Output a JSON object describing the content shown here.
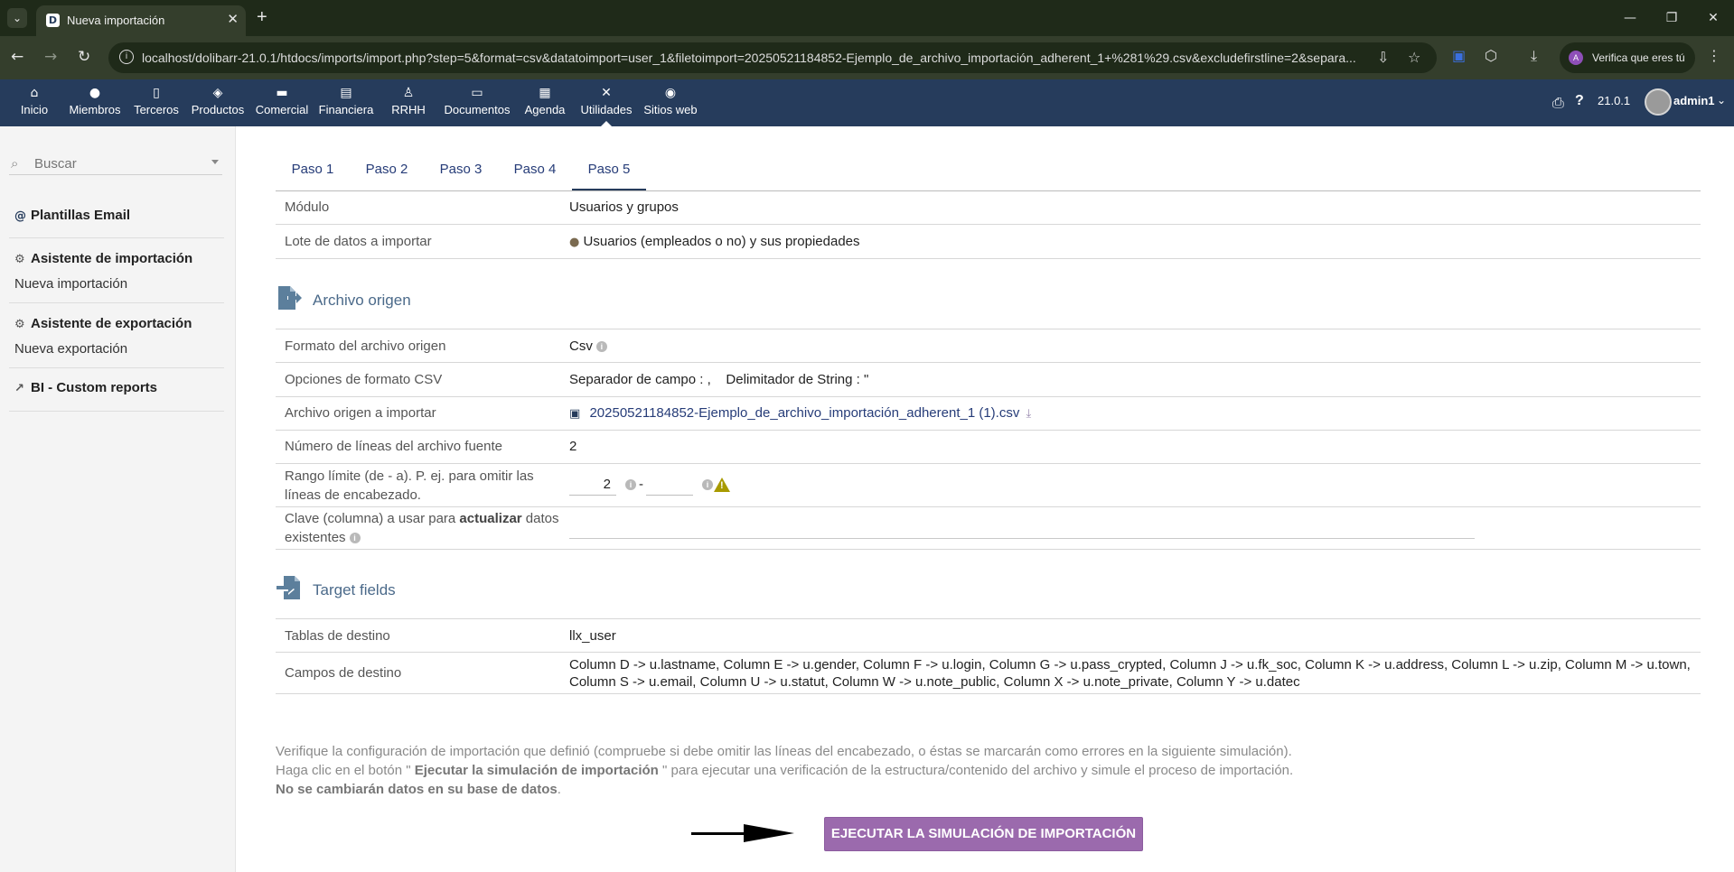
{
  "browser": {
    "tab_title": "Nueva importación",
    "favicon_letter": "D",
    "url": "localhost/dolibarr-21.0.1/htdocs/imports/import.php?step=5&format=csv&datatoimport=user_1&filetoimport=20250521184852-Ejemplo_de_archivo_importación_adherent_1+%281%29.csv&excludefirstline=2&separa...",
    "profile_chip": "Verifica que eres tú",
    "profile_initial": "A"
  },
  "topmenu": {
    "items": [
      {
        "label": "Inicio",
        "icon": "home-icon"
      },
      {
        "label": "Miembros",
        "icon": "user-icon"
      },
      {
        "label": "Terceros",
        "icon": "building-icon"
      },
      {
        "label": "Productos",
        "icon": "cube-icon"
      },
      {
        "label": "Comercial",
        "icon": "briefcase-icon"
      },
      {
        "label": "Financiera",
        "icon": "invoice-icon"
      },
      {
        "label": "RRHH",
        "icon": "person-tie-icon"
      },
      {
        "label": "Documentos",
        "icon": "folder-icon"
      },
      {
        "label": "Agenda",
        "icon": "calendar-icon"
      },
      {
        "label": "Utilidades",
        "icon": "tools-icon"
      },
      {
        "label": "Sitios web",
        "icon": "globe-icon"
      }
    ],
    "active": "Utilidades",
    "version": "21.0.1",
    "username": "admin1"
  },
  "sidebar": {
    "search_placeholder": "Buscar",
    "email_templates": "Plantillas Email",
    "import_wizard": "Asistente de importación",
    "new_import": "Nueva importación",
    "export_wizard": "Asistente de exportación",
    "new_export": "Nueva exportación",
    "bi_reports": "BI - Custom reports"
  },
  "steps": [
    "Paso 1",
    "Paso 2",
    "Paso 3",
    "Paso 4",
    "Paso 5"
  ],
  "active_step": "Paso 5",
  "general": {
    "module_label": "Módulo",
    "module_value": "Usuarios y grupos",
    "dataset_label": "Lote de datos a importar",
    "dataset_value": "Usuarios (empleados o no) y sus propiedades"
  },
  "source_section": {
    "title": "Archivo origen",
    "format_label": "Formato del archivo origen",
    "format_value": "Csv",
    "csv_options_label": "Opciones de formato CSV",
    "csv_options_value": "Separador de campo : ,    Delimitador de String : \"",
    "file_label": "Archivo origen a importar",
    "file_value": "20250521184852-Ejemplo_de_archivo_importación_adherent_1 (1).csv",
    "lines_label": "Número de líneas del archivo fuente",
    "lines_value": "2",
    "range_label_1": "Rango límite (de - a). P. ej. para omitir las",
    "range_label_2": "líneas de encabezado.",
    "range_from": "2",
    "range_to": "",
    "range_sep": "-",
    "key_label_1a": "Clave (columna) a usar para ",
    "key_label_1b": "actualizar",
    "key_label_1c": " datos",
    "key_label_2": "existentes",
    "key_value": ""
  },
  "target_section": {
    "title": "Target fields",
    "tables_label": "Tablas de destino",
    "tables_value": "llx_user",
    "fields_label": "Campos de destino",
    "fields_line1": "Column D -> u.lastname, Column E -> u.gender, Column F -> u.login, Column G -> u.pass_crypted, Column J -> u.fk_soc, Column K -> u.address, Column L -> u.zip, Column M -> u.town,",
    "fields_line2": "Column S -> u.email, Column U -> u.statut, Column W -> u.note_public, Column X -> u.note_private, Column Y -> u.datec"
  },
  "help": {
    "line1": "Verifique la configuración de importación que definió (compruebe si debe omitir las líneas del encabezado, o éstas se marcarán como errores en la siguiente simulación).",
    "line2_a": "Haga clic en el botón \" ",
    "line2_b": "Ejecutar la simulación de importación",
    "line2_c": " \" para ejecutar una verificación de la estructura/contenido del archivo y simule el proceso de importación.",
    "line3_a": "No se cambiarán datos en su base de datos",
    "line3_b": "."
  },
  "button": {
    "simulate_label": "EJECUTAR LA SIMULACIÓN DE IMPORTACIÓN"
  },
  "colors": {
    "menu_bg": "#263c5c",
    "button_bg": "#9b6aad",
    "section_title": "#4b6a8a",
    "link": "#263c78",
    "browser_frame": "#343e2c"
  }
}
